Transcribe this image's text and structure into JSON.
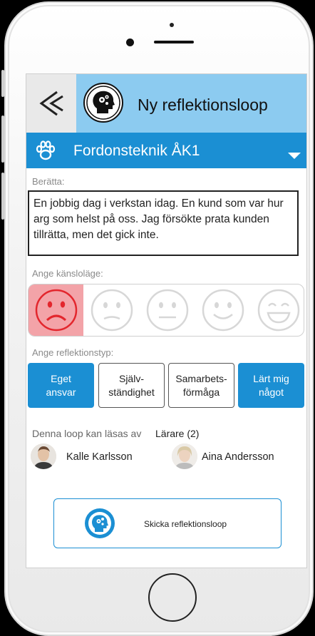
{
  "header": {
    "title": "Ny reflektionsloop"
  },
  "course": {
    "name": "Fordonsteknik ÅK1"
  },
  "story": {
    "label": "Berätta:",
    "text": "En jobbig dag i verkstan idag. En kund som var hur arg som helst på oss. Jag försökte prata kunden tillrätta, men det gick inte."
  },
  "mood": {
    "label": "Ange känsloläge:",
    "selected_index": 0,
    "options": [
      "very-sad",
      "sad",
      "neutral",
      "happy",
      "very-happy"
    ],
    "selected_color": "#f3a3a8",
    "selected_icon_color": "#e3262d"
  },
  "reflection_type": {
    "label": "Ange reflektionstyp:",
    "options": [
      {
        "label_line1": "Eget",
        "label_line2": "ansvar",
        "active": true
      },
      {
        "label_line1": "Själv-",
        "label_line2": "ständighet",
        "active": false
      },
      {
        "label_line1": "Samarbets-",
        "label_line2": "förmåga",
        "active": false
      },
      {
        "label_line1": "Lärt mig",
        "label_line2": "något",
        "active": true
      }
    ]
  },
  "readers": {
    "label": "Denna loop kan läsas av",
    "group": "Lärare (2)",
    "people": [
      {
        "name": "Kalle Karlsson"
      },
      {
        "name": "Aina Andersson"
      }
    ]
  },
  "send": {
    "label": "Skicka reflektionsloop"
  },
  "colors": {
    "header_bg": "#8ccbf0",
    "accent": "#1b8fd3"
  }
}
